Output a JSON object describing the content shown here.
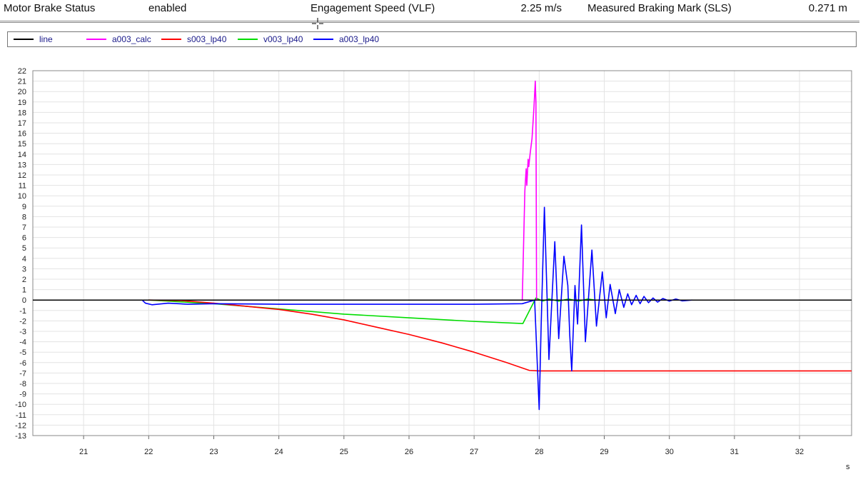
{
  "header": {
    "motor_brake_status_label": "Motor Brake Status",
    "motor_brake_status_value": "enabled",
    "engagement_speed_label": "Engagement Speed (VLF)",
    "engagement_speed_value": "2.25 m/s",
    "braking_mark_label": "Measured Braking Mark (SLS)",
    "braking_mark_value": "0.271 m"
  },
  "chart_data": {
    "type": "line",
    "xlabel": "s",
    "ylabel": "",
    "xlim": [
      20.22,
      32.8
    ],
    "ylim": [
      -13,
      22
    ],
    "grid": true,
    "legend_position": "top",
    "xticks": [
      21,
      22,
      23,
      24,
      25,
      26,
      27,
      28,
      29,
      30,
      31,
      32
    ],
    "yticks": [
      22,
      21,
      20,
      19,
      18,
      17,
      16,
      15,
      14,
      13,
      12,
      11,
      10,
      9,
      8,
      7,
      6,
      5,
      4,
      3,
      2,
      1,
      0,
      -1,
      -2,
      -3,
      -4,
      -5,
      -6,
      -7,
      -8,
      -9,
      -10,
      -11,
      -12,
      -13
    ],
    "series": [
      {
        "name": "line",
        "color": "#000000",
        "points": [
          [
            20.22,
            0
          ],
          [
            32.8,
            0
          ]
        ]
      },
      {
        "name": "a003_calc",
        "color": "#ff00ff",
        "points": [
          [
            27.74,
            0
          ],
          [
            27.78,
            10.5
          ],
          [
            27.8,
            12.6
          ],
          [
            27.81,
            11
          ],
          [
            27.83,
            13.5
          ],
          [
            27.84,
            12.8
          ],
          [
            27.86,
            14
          ],
          [
            27.89,
            15.5
          ],
          [
            27.92,
            18.5
          ],
          [
            27.94,
            21
          ],
          [
            27.95,
            19
          ],
          [
            27.96,
            0
          ]
        ]
      },
      {
        "name": "s003_lp40",
        "color": "#ff0000",
        "points": [
          [
            22,
            0
          ],
          [
            22.5,
            -0.05
          ],
          [
            23,
            -0.3
          ],
          [
            23.5,
            -0.6
          ],
          [
            24,
            -0.9
          ],
          [
            24.5,
            -1.35
          ],
          [
            25,
            -1.9
          ],
          [
            25.5,
            -2.6
          ],
          [
            26,
            -3.3
          ],
          [
            26.5,
            -4.1
          ],
          [
            27,
            -5
          ],
          [
            27.5,
            -6
          ],
          [
            27.85,
            -6.75
          ],
          [
            28,
            -6.8
          ],
          [
            32.8,
            -6.8
          ]
        ]
      },
      {
        "name": "v003_lp40",
        "color": "#00dd00",
        "points": [
          [
            22,
            0
          ],
          [
            23,
            -0.35
          ],
          [
            24,
            -0.85
          ],
          [
            25,
            -1.35
          ],
          [
            26,
            -1.7
          ],
          [
            27,
            -2.05
          ],
          [
            27.75,
            -2.25
          ],
          [
            27.95,
            0.2
          ],
          [
            28.05,
            -0.1
          ],
          [
            28.15,
            0.1
          ],
          [
            28.3,
            -0.1
          ],
          [
            28.45,
            0.1
          ],
          [
            28.6,
            -0.1
          ],
          [
            28.75,
            0.1
          ],
          [
            28.85,
            0
          ]
        ]
      },
      {
        "name": "a003_lp40",
        "color": "#0000ff",
        "points": [
          [
            21.9,
            0
          ],
          [
            21.95,
            -0.3
          ],
          [
            22.05,
            -0.45
          ],
          [
            22.3,
            -0.3
          ],
          [
            22.6,
            -0.4
          ],
          [
            23,
            -0.35
          ],
          [
            24,
            -0.4
          ],
          [
            25,
            -0.4
          ],
          [
            26,
            -0.4
          ],
          [
            27,
            -0.4
          ],
          [
            27.74,
            -0.35
          ],
          [
            27.93,
            0
          ],
          [
            28.0,
            -10.5
          ],
          [
            28.03,
            -2.5
          ],
          [
            28.08,
            8.9
          ],
          [
            28.15,
            -5.7
          ],
          [
            28.24,
            5.6
          ],
          [
            28.3,
            -3.7
          ],
          [
            28.38,
            4.2
          ],
          [
            28.44,
            1.4
          ],
          [
            28.47,
            -3.4
          ],
          [
            28.5,
            -6.8
          ],
          [
            28.55,
            1.4
          ],
          [
            28.59,
            -2.3
          ],
          [
            28.65,
            7.2
          ],
          [
            28.71,
            -4
          ],
          [
            28.81,
            4.8
          ],
          [
            28.88,
            -2.5
          ],
          [
            28.97,
            2.7
          ],
          [
            29.03,
            -1.7
          ],
          [
            29.09,
            1.5
          ],
          [
            29.17,
            -1.3
          ],
          [
            29.23,
            1.0
          ],
          [
            29.3,
            -0.7
          ],
          [
            29.36,
            0.6
          ],
          [
            29.42,
            -0.45
          ],
          [
            29.49,
            0.45
          ],
          [
            29.55,
            -0.35
          ],
          [
            29.61,
            0.35
          ],
          [
            29.68,
            -0.25
          ],
          [
            29.75,
            0.2
          ],
          [
            29.82,
            -0.2
          ],
          [
            29.9,
            0.15
          ],
          [
            30,
            -0.1
          ],
          [
            30.1,
            0.1
          ],
          [
            30.2,
            -0.08
          ],
          [
            30.35,
            0
          ]
        ]
      }
    ]
  }
}
